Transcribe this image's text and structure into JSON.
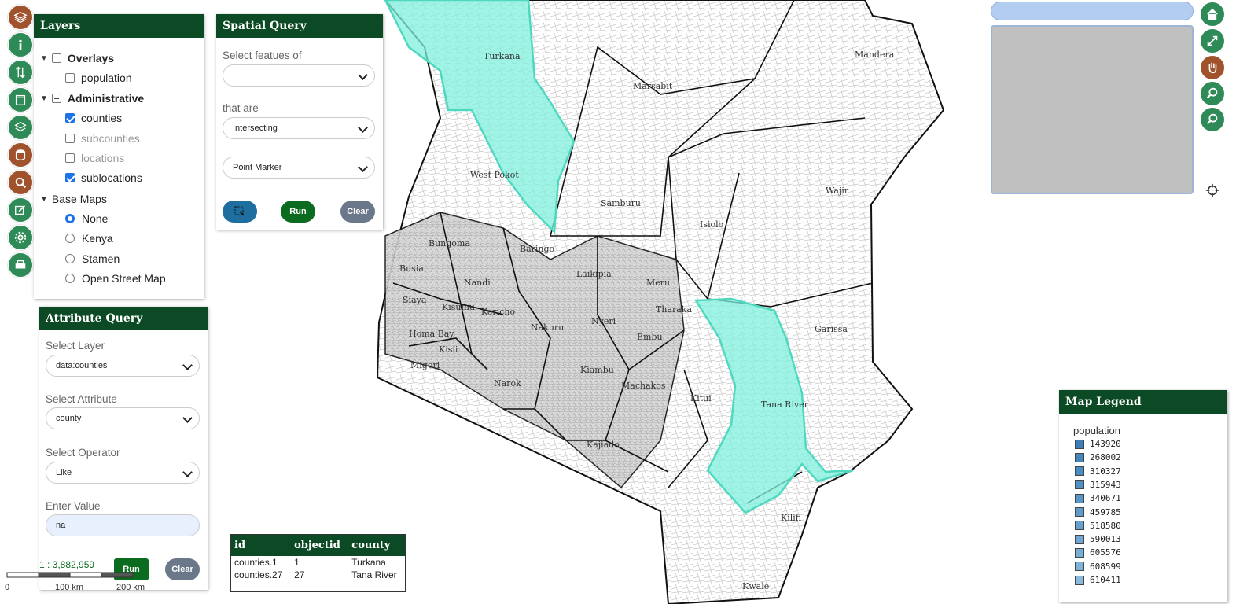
{
  "map": {
    "counties": [
      "Turkana",
      "Marsabit",
      "Mandera",
      "Wajir",
      "Samburu",
      "Isiolo",
      "West Pokot",
      "Baringo",
      "Bungoma",
      "Busia",
      "Nandi",
      "Siaya",
      "Kisumu",
      "Kericho",
      "Homa Bay",
      "Kisii",
      "Migori",
      "Laikipia",
      "Meru",
      "Tharaka",
      "Nyeri",
      "Embu",
      "Nakuru",
      "Kiambu",
      "Machakos",
      "Narok",
      "Kitui",
      "Kajiado",
      "Tana River",
      "Garissa",
      "Kilifi",
      "Kwale"
    ],
    "highlight_color": "#7ff0dc"
  },
  "toolbar": {
    "icons": [
      "layers-icon",
      "info-icon",
      "swap-icon",
      "bookmark-icon",
      "layers-stack-icon",
      "database-icon",
      "search-icon",
      "edit-icon",
      "settings-icon",
      "print-icon"
    ]
  },
  "layers_panel": {
    "title": "Layers",
    "overlays_label": "Overlays",
    "population_label": "population",
    "administrative_label": "Administrative",
    "counties_label": "counties",
    "subcounties_label": "subcounties",
    "locations_label": "locations",
    "sublocations_label": "sublocations",
    "basemaps_label": "Base Maps",
    "basemaps": [
      "None",
      "Kenya",
      "Stamen",
      "Open Street Map"
    ],
    "selected_basemap": "None"
  },
  "spatial_query": {
    "title": "Spatial Query",
    "select_label": "Select featues of",
    "select_value": "",
    "that_are_label": "that are",
    "relation_value": "Intersecting",
    "marker_value": "Point Marker",
    "run_label": "Run",
    "clear_label": "Clear"
  },
  "attribute_query": {
    "title": "Attribute Query",
    "layer_label": "Select Layer",
    "layer_value": "data:counties",
    "attribute_label": "Select Attribute",
    "attribute_value": "county",
    "operator_label": "Select Operator",
    "operator_value": "Like",
    "value_label": "Enter Value",
    "value_value": "na",
    "run_label": "Run",
    "clear_label": "Clear"
  },
  "scale": {
    "ratio": "1 : 3,882,959",
    "ticks": [
      "0",
      "100 km",
      "200 km"
    ]
  },
  "result_table": {
    "headers": [
      "id",
      "objectid",
      "county"
    ],
    "rows": [
      [
        "counties.1",
        "1",
        "Turkana"
      ],
      [
        "counties.27",
        "27",
        "Tana River"
      ]
    ]
  },
  "legend": {
    "title": "Map Legend",
    "layer": "population",
    "items": [
      "143920",
      "268002",
      "310327",
      "315943",
      "340671",
      "459785",
      "518580",
      "590013",
      "605576",
      "608599",
      "610411"
    ],
    "colors": [
      "#3d7fb8",
      "#4286bd",
      "#498cc2",
      "#5091c5",
      "#5796c8",
      "#5f9ccc",
      "#67a2cf",
      "#70a8d3",
      "#78aed6",
      "#80b3d9",
      "#89b9dc"
    ]
  }
}
